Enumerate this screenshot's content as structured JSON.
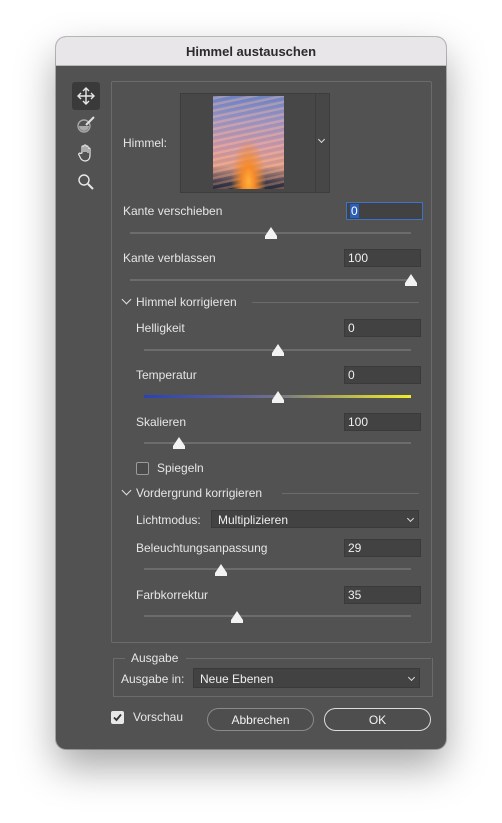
{
  "window": {
    "title": "Himmel austauschen"
  },
  "tools": [
    {
      "name": "move-tool",
      "icon": "move-icon"
    },
    {
      "name": "sky-brush-tool",
      "icon": "brush-icon"
    },
    {
      "name": "hand-tool",
      "icon": "hand-icon"
    },
    {
      "name": "zoom-tool",
      "icon": "zoom-icon"
    }
  ],
  "sky": {
    "label": "Himmel:"
  },
  "edge_shift": {
    "label": "Kante verschieben",
    "value": "0",
    "level": 0.5
  },
  "edge_fade": {
    "label": "Kante verblassen",
    "value": "100",
    "level": 1.0
  },
  "sky_adjust": {
    "header": "Himmel korrigieren",
    "brightness": {
      "label": "Helligkeit",
      "value": "0",
      "level": 0.5
    },
    "temperature": {
      "label": "Temperatur",
      "value": "0",
      "level": 0.5
    },
    "scale": {
      "label": "Skalieren",
      "value": "100",
      "level": 0.13
    },
    "flip": {
      "label": "Spiegeln",
      "checked": false
    }
  },
  "foreground_adjust": {
    "header": "Vordergrund korrigieren",
    "lighting_mode": {
      "label": "Lichtmodus:",
      "value": "Multiplizieren"
    },
    "lighting_adjust": {
      "label": "Beleuchtungsanpassung",
      "value": "29",
      "level": 0.29
    },
    "color_adjust": {
      "label": "Farbkorrektur",
      "value": "35",
      "level": 0.35
    }
  },
  "output": {
    "group_label": "Ausgabe",
    "label": "Ausgabe in:",
    "value": "Neue Ebenen"
  },
  "preview": {
    "label": "Vorschau",
    "checked": true
  },
  "buttons": {
    "cancel": "Abbrechen",
    "ok": "OK"
  }
}
